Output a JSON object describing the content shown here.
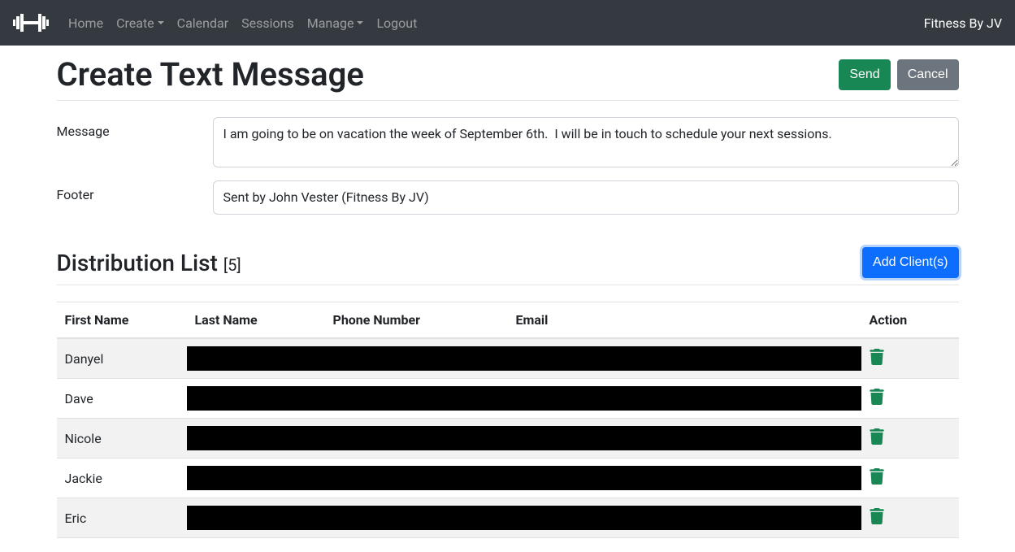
{
  "nav": {
    "items": [
      "Home",
      "Create",
      "Calendar",
      "Sessions",
      "Manage",
      "Logout"
    ],
    "brand_right": "Fitness By JV"
  },
  "page": {
    "title": "Create Text Message",
    "send_label": "Send",
    "cancel_label": "Cancel"
  },
  "form": {
    "message_label": "Message",
    "message_value": "I am going to be on vacation the week of September 6th.  I will be in touch to schedule your next sessions.",
    "footer_label": "Footer",
    "footer_value": "Sent by John Vester (Fitness By JV)"
  },
  "distribution": {
    "title": "Distribution List",
    "count": "[5]",
    "add_label": "Add Client(s)",
    "columns": {
      "first": "First Name",
      "last": "Last Name",
      "phone": "Phone Number",
      "email": "Email",
      "action": "Action"
    },
    "rows": [
      {
        "first": "Danyel"
      },
      {
        "first": "Dave"
      },
      {
        "first": "Nicole"
      },
      {
        "first": "Jackie"
      },
      {
        "first": "Eric"
      }
    ]
  }
}
